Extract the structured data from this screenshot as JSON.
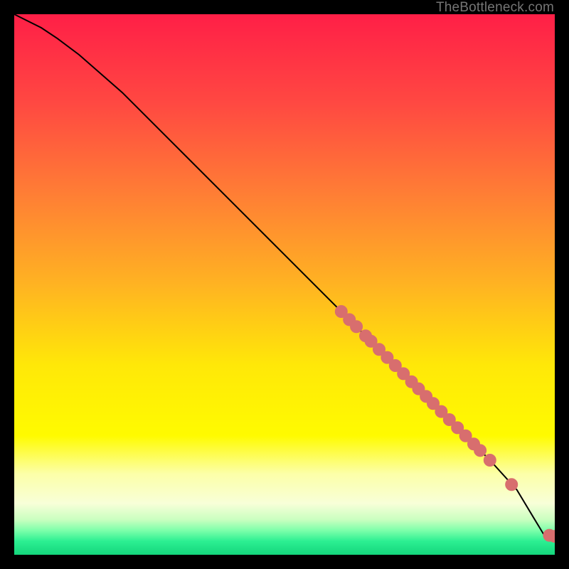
{
  "attribution": "TheBottleneck.com",
  "colors": {
    "gradient_stops": [
      {
        "offset": 0.0,
        "color": "#ff1f47"
      },
      {
        "offset": 0.16,
        "color": "#ff4742"
      },
      {
        "offset": 0.33,
        "color": "#ff7d35"
      },
      {
        "offset": 0.5,
        "color": "#ffb322"
      },
      {
        "offset": 0.65,
        "color": "#ffe808"
      },
      {
        "offset": 0.78,
        "color": "#fffb00"
      },
      {
        "offset": 0.85,
        "color": "#fcffa8"
      },
      {
        "offset": 0.905,
        "color": "#f8ffd8"
      },
      {
        "offset": 0.935,
        "color": "#caffc0"
      },
      {
        "offset": 0.955,
        "color": "#7dffaa"
      },
      {
        "offset": 0.975,
        "color": "#2cef92"
      },
      {
        "offset": 1.0,
        "color": "#14d67c"
      }
    ],
    "curve": "#000000",
    "point_fill": "#d86e6e",
    "point_stroke": "#d86e6e"
  },
  "chart_data": {
    "type": "line",
    "title": "",
    "xlabel": "",
    "ylabel": "",
    "xlim": [
      0,
      100
    ],
    "ylim": [
      0,
      100
    ],
    "curve": {
      "x": [
        0,
        2,
        5,
        8,
        12,
        20,
        30,
        40,
        50,
        60,
        70,
        80,
        88,
        93,
        96,
        98,
        100
      ],
      "y": [
        100,
        99,
        97.5,
        95.5,
        92.5,
        85.5,
        75.5,
        65.5,
        55.5,
        45.5,
        35.5,
        25.5,
        17.5,
        12,
        7,
        3.7,
        3.4
      ]
    },
    "series": [
      {
        "name": "points",
        "x": [
          60.5,
          62.0,
          63.3,
          65.0,
          66.0,
          67.5,
          69.0,
          70.5,
          72.0,
          73.5,
          74.8,
          76.2,
          77.5,
          79.0,
          80.5,
          82.0,
          83.5,
          85.0,
          86.2,
          88.0,
          92.0,
          99.0,
          100.0
        ],
        "y": [
          45.0,
          43.5,
          42.2,
          40.5,
          39.5,
          38.0,
          36.5,
          35.0,
          33.5,
          32.0,
          30.7,
          29.3,
          28.0,
          26.5,
          25.0,
          23.5,
          22.0,
          20.5,
          19.3,
          17.5,
          13.0,
          3.6,
          3.4
        ]
      }
    ]
  }
}
